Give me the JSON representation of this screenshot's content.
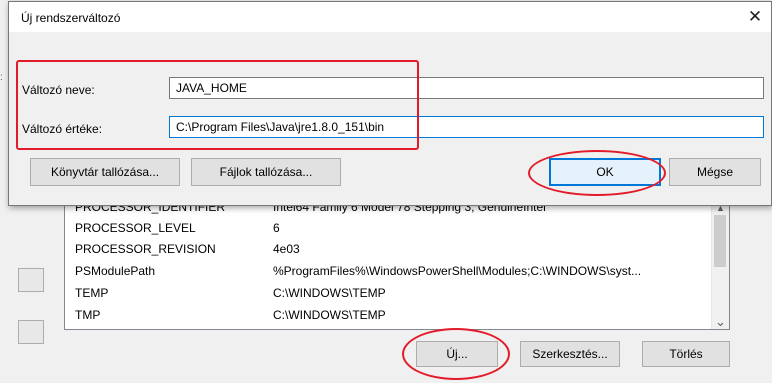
{
  "dialog": {
    "title": "Új rendszerváltozó",
    "close_glyph": "✕",
    "name_label": "Változó neve:",
    "name_value": "JAVA_HOME",
    "value_label": "Változó értéke:",
    "value_value": "C:\\Program Files\\Java\\jre1.8.0_151\\bin",
    "browse_dir_label": "Könyvtár tallózása...",
    "browse_file_label": "Fájlok tallózása...",
    "ok_label": "OK",
    "cancel_label": "Mégse"
  },
  "system_vars": {
    "rows": [
      {
        "name": "PROCESSOR_IDENTIFIER",
        "value": "Intel64 Family 6 Model 78 Stepping 3, GenuineIntel"
      },
      {
        "name": "PROCESSOR_LEVEL",
        "value": "6"
      },
      {
        "name": "PROCESSOR_REVISION",
        "value": "4e03"
      },
      {
        "name": "PSModulePath",
        "value": "%ProgramFiles%\\WindowsPowerShell\\Modules;C:\\WINDOWS\\syst..."
      },
      {
        "name": "TEMP",
        "value": "C:\\WINDOWS\\TEMP"
      },
      {
        "name": "TMP",
        "value": "C:\\WINDOWS\\TEMP"
      }
    ],
    "new_label": "Új...",
    "edit_label": "Szerkesztés...",
    "delete_label": "Törlés"
  },
  "icons": {
    "scroll_up": "▲",
    "scroll_down": "⌄"
  },
  "colors": {
    "annotation_red": "#e21b2a",
    "focus_blue": "#0078d7"
  }
}
